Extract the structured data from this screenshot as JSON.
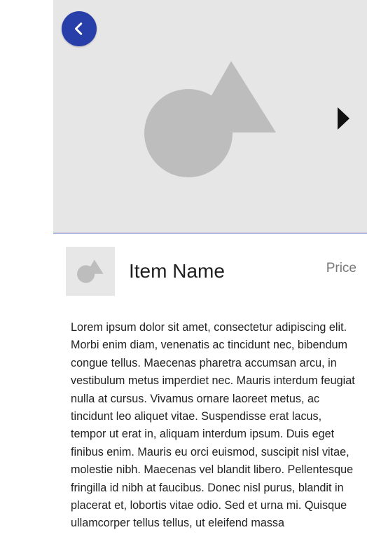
{
  "hero": {
    "image_icon": "image-placeholder-icon",
    "back_icon": "chevron-left-icon",
    "next_icon": "play-arrow-icon"
  },
  "item": {
    "thumbnail_icon": "image-placeholder-icon",
    "name": "Item Name",
    "price": "Price"
  },
  "description": "Lorem ipsum dolor sit amet, consectetur adipiscing elit. Morbi enim diam, venenatis ac tincidunt nec, bibendum congue tellus. Maecenas pharetra accumsan arcu, in vestibulum metus imperdiet nec. Mauris interdum feugiat nulla at cursus. Vivamus ornare laoreet metus, ac tincidunt leo aliquet vitae. Suspendisse erat lacus, tempor ut erat in, aliquam interdum ipsum. Duis eget finibus enim. Mauris eu orci euismod, suscipit nisl vitae, molestie nibh. Maecenas vel blandit libero. Pellentesque fringilla id nibh at faucibus. Donec nisl purus, blandit in placerat et, lobortis vitae odio. Sed et urna mi. Quisque ullamcorper tellus tellus, ut eleifend massa",
  "colors": {
    "accent": "#283ea8",
    "hero_bg": "#e6e6e6",
    "placeholder_shape": "#bdbdbd"
  }
}
